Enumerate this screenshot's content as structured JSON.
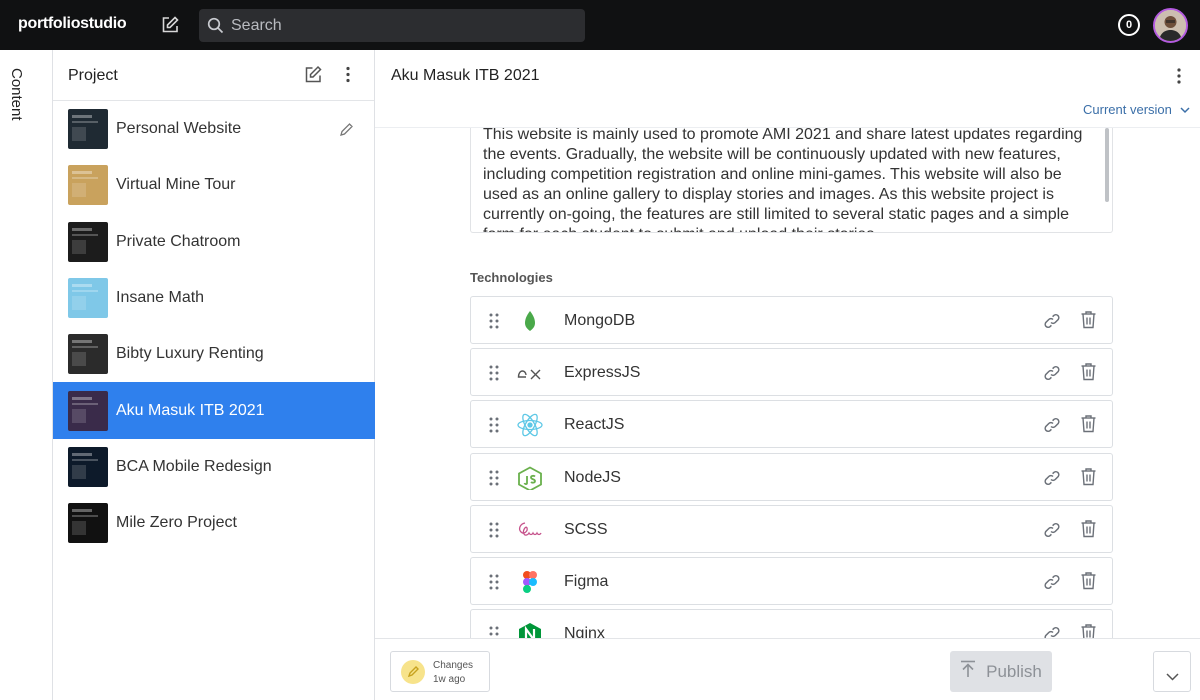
{
  "topbar": {
    "brand": "portfoliostudio",
    "search_placeholder": "Search",
    "notification_count": "0"
  },
  "rail": {
    "label": "Content"
  },
  "projects": {
    "title": "Project",
    "items": [
      {
        "label": "Personal Website",
        "thumb": "#1f2a33"
      },
      {
        "label": "Virtual Mine Tour",
        "thumb": "#c9a25d"
      },
      {
        "label": "Private Chatroom",
        "thumb": "#1c1c1c"
      },
      {
        "label": "Insane Math",
        "thumb": "#7fc8e8"
      },
      {
        "label": "Bibty Luxury Renting",
        "thumb": "#2b2b2b"
      },
      {
        "label": "Aku Masuk ITB 2021",
        "thumb": "#3a2b4a",
        "active": true
      },
      {
        "label": "BCA Mobile Redesign",
        "thumb": "#0d1a2a"
      },
      {
        "label": "Mile Zero Project",
        "thumb": "#111111"
      }
    ]
  },
  "main": {
    "title": "Aku Masuk ITB 2021",
    "version": "Current version",
    "description": "This website is mainly used to promote AMI 2021 and share latest updates regarding the events. Gradually, the website will be continuously updated with new features, including competition registration and online mini-games. This website will also be used as an online gallery to display stories and images. As this website project is currently on-going, the features are still limited to several static pages and a simple form for each student to submit and upload their stories.",
    "technologies_label": "Technologies",
    "technologies": [
      {
        "name": "MongoDB",
        "icon": "mongodb-icon",
        "color": "#4aa94a"
      },
      {
        "name": "ExpressJS",
        "icon": "express-icon",
        "color": "#555555"
      },
      {
        "name": "ReactJS",
        "icon": "react-icon",
        "color": "#5ec8e6"
      },
      {
        "name": "NodeJS",
        "icon": "nodejs-icon",
        "color": "#6ab04c"
      },
      {
        "name": "SCSS",
        "icon": "scss-icon",
        "color": "#c6538c"
      },
      {
        "name": "Figma",
        "icon": "figma-icon",
        "color": "#f24e1e"
      },
      {
        "name": "Nginx",
        "icon": "nginx-icon",
        "color": "#009639"
      }
    ]
  },
  "footer": {
    "changes_title": "Changes",
    "changes_time": "1w ago",
    "publish_label": "Publish"
  },
  "colors": {
    "topbar": "#101112",
    "active": "#2f80ed",
    "version_link": "#3b6fa8"
  }
}
